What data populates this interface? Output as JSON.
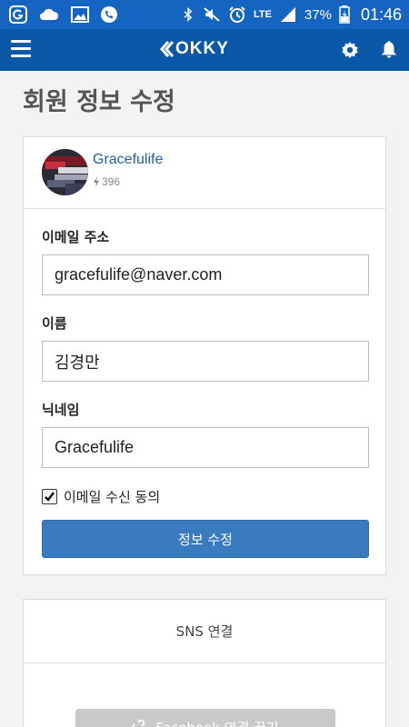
{
  "status_bar": {
    "battery_pct": "37%",
    "time": "01:46",
    "network": "LTE",
    "icons": [
      "g-app-icon",
      "cloud-icon",
      "image-icon",
      "phone-icon",
      "bluetooth-icon",
      "mute-icon",
      "alarm-icon",
      "signal-icon",
      "battery-icon"
    ]
  },
  "app_bar": {
    "brand": "OKKY",
    "menu_icon": "hamburger-menu-icon",
    "settings_icon": "gear-icon",
    "notifications_icon": "bell-icon",
    "color": "#0b57a8"
  },
  "page": {
    "title": "회원 정보 수정"
  },
  "profile": {
    "name": "Gracefulife",
    "score": "396"
  },
  "form": {
    "email_label": "이메일 주소",
    "email_value": "gracefulife@naver.com",
    "name_label": "이름",
    "name_value": "김경만",
    "nickname_label": "닉네임",
    "nickname_value": "Gracefulife",
    "consent_label": "이메일 수신 동의",
    "consent_checked": true,
    "submit_label": "정보 수정"
  },
  "sns": {
    "title": "SNS 연결",
    "facebook_button": "Facebook 연결 끊기"
  }
}
